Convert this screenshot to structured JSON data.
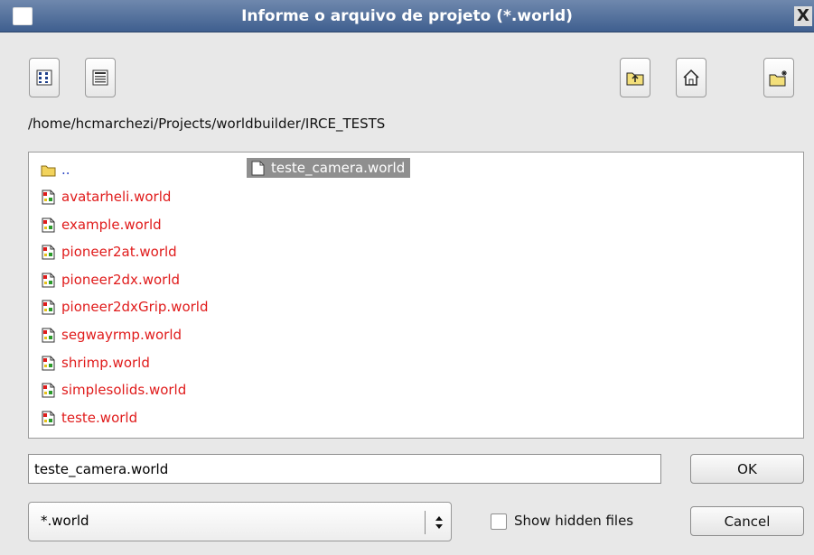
{
  "window": {
    "title": "Informe o arquivo de projeto (*.world)",
    "close_glyph": "X"
  },
  "toolbar": {
    "left_buttons": [
      {
        "name": "icon-view-button",
        "icon": "icon-view-icon"
      },
      {
        "name": "detail-view-button",
        "icon": "detail-view-icon"
      }
    ],
    "right_buttons": [
      {
        "name": "parent-folder-button",
        "icon": "folder-up-icon"
      },
      {
        "name": "home-button",
        "icon": "home-icon"
      },
      {
        "name": "new-folder-button",
        "icon": "new-folder-icon"
      }
    ]
  },
  "current_path": "/home/hcmarchezi/Projects/worldbuilder/IRCE_TESTS",
  "files": {
    "parent": "..",
    "items": [
      "avatarheli.world",
      "example.world",
      "pioneer2at.world",
      "pioneer2dx.world",
      "pioneer2dxGrip.world",
      "segwayrmp.world",
      "shrimp.world",
      "simplesolids.world",
      "teste.world"
    ],
    "selected": "teste_camera.world"
  },
  "filename_input": {
    "value": "teste_camera.world"
  },
  "buttons": {
    "ok": "OK",
    "cancel": "Cancel"
  },
  "filter": {
    "selected": "*.world"
  },
  "show_hidden": {
    "label": "Show hidden files",
    "checked": false
  },
  "colors": {
    "titlebar": "#4d6c9b",
    "file_text": "#e01b1b",
    "parent_text": "#2a44c4",
    "selection": "#8f8f8f"
  }
}
